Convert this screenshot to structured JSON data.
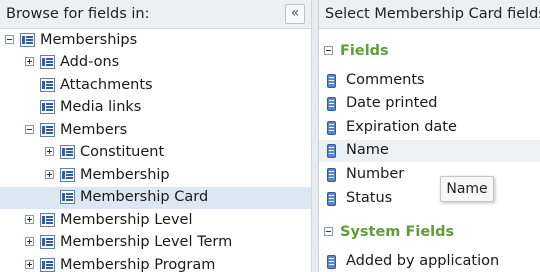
{
  "left_pane": {
    "title": "Browse for fields in:",
    "collapse_glyph": "«",
    "tree": [
      {
        "label": "Memberships",
        "expander": "minus"
      },
      {
        "label": "Add-ons",
        "expander": "plus"
      },
      {
        "label": "Attachments",
        "expander": "none"
      },
      {
        "label": "Media links",
        "expander": "none"
      },
      {
        "label": "Members",
        "expander": "minus"
      },
      {
        "label": "Constituent",
        "expander": "plus"
      },
      {
        "label": "Membership",
        "expander": "plus"
      },
      {
        "label": "Membership Card",
        "expander": "none",
        "selected": true
      },
      {
        "label": "Membership Level",
        "expander": "plus"
      },
      {
        "label": "Membership Level Term",
        "expander": "plus"
      },
      {
        "label": "Membership Program",
        "expander": "plus"
      }
    ]
  },
  "right_pane": {
    "title": "Select Membership Card fields:",
    "sections": [
      {
        "label": "Fields",
        "fields": [
          "Comments",
          "Date printed",
          "Expiration date",
          "Name",
          "Number",
          "Status"
        ]
      },
      {
        "label": "System Fields",
        "fields": [
          "Added by application"
        ]
      }
    ],
    "tooltip": "Name"
  },
  "colors": {
    "section_header": "#5d9e38",
    "selection": "#dde7f3",
    "hover": "#eef1f4"
  }
}
